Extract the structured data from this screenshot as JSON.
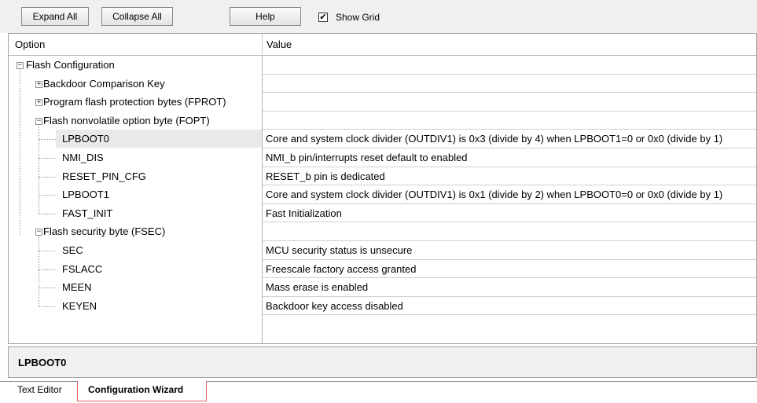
{
  "toolbar": {
    "expand_all": "Expand All",
    "collapse_all": "Collapse All",
    "help": "Help",
    "show_grid_label": "Show Grid",
    "show_grid_checked": true
  },
  "tree": {
    "col_option": "Option",
    "col_value": "Value",
    "rows": [
      {
        "option": "Flash Configuration",
        "value": "",
        "expander": "minus"
      },
      {
        "option": "Backdoor Comparison Key",
        "value": "",
        "expander": "plus"
      },
      {
        "option": "Program flash protection bytes (FPROT)",
        "value": "",
        "expander": "plus"
      },
      {
        "option": "Flash nonvolatile option byte (FOPT)",
        "value": "",
        "expander": "minus"
      },
      {
        "option": "LPBOOT0",
        "value": "Core and system clock divider (OUTDIV1) is 0x3 (divide by 4) when LPBOOT1=0 or 0x0 (divide by 1)",
        "selected": true
      },
      {
        "option": "NMI_DIS",
        "value": "NMI_b pin/interrupts reset default to enabled"
      },
      {
        "option": "RESET_PIN_CFG",
        "value": "RESET_b pin is dedicated"
      },
      {
        "option": "LPBOOT1",
        "value": "Core and system clock divider (OUTDIV1) is 0x1 (divide by 2) when LPBOOT0=0 or 0x0 (divide by 1)"
      },
      {
        "option": "FAST_INIT",
        "value": "Fast Initialization"
      },
      {
        "option": "Flash security byte (FSEC)",
        "value": "",
        "expander": "minus"
      },
      {
        "option": "SEC",
        "value": "MCU security status is unsecure"
      },
      {
        "option": "FSLACC",
        "value": "Freescale factory access granted"
      },
      {
        "option": "MEEN",
        "value": "Mass erase is enabled"
      },
      {
        "option": "KEYEN",
        "value": "Backdoor key access disabled"
      }
    ]
  },
  "description": {
    "title": "LPBOOT0"
  },
  "tabs": [
    {
      "label": "Text Editor",
      "active": false
    },
    {
      "label": "Configuration Wizard",
      "active": true
    }
  ]
}
